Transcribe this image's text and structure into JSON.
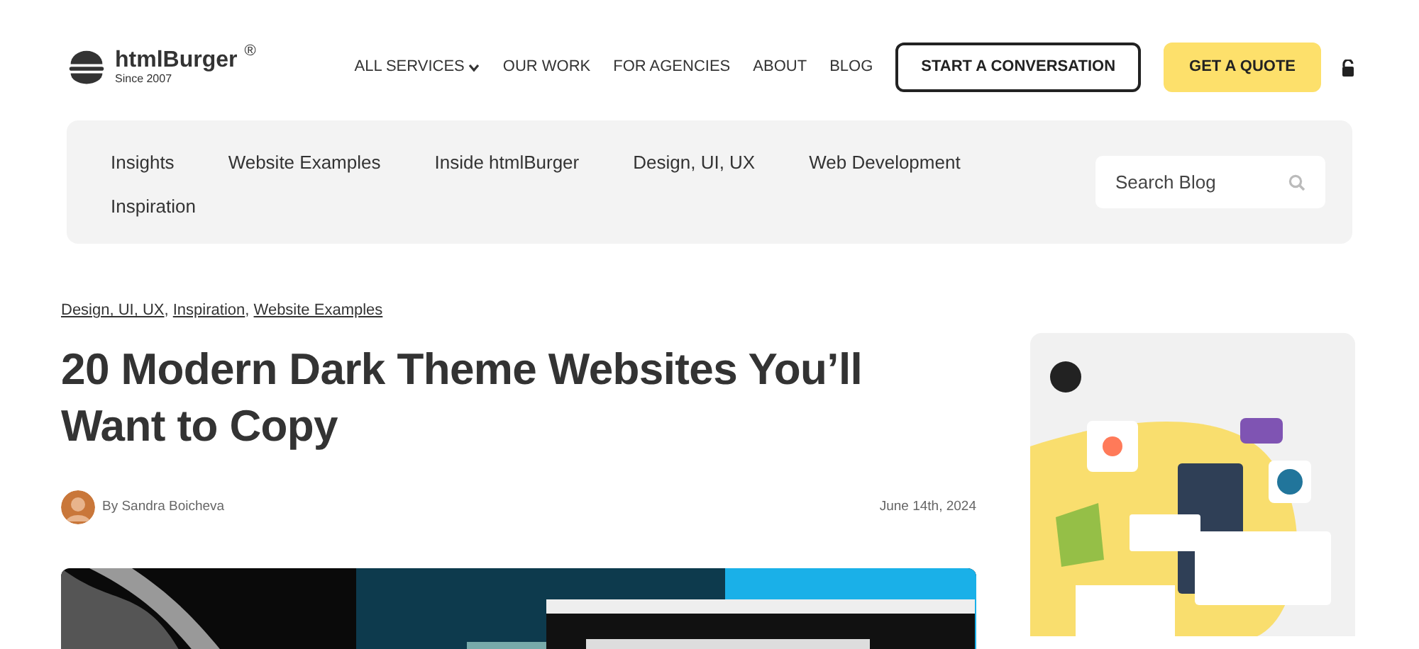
{
  "header": {
    "logo": {
      "name": "htmlBurger",
      "mark": "®",
      "since": "Since 2007"
    },
    "nav": [
      {
        "label": "ALL SERVICES",
        "kind": "dropdown"
      },
      {
        "label": "OUR WORK",
        "kind": "link"
      },
      {
        "label": "FOR AGENCIES",
        "kind": "link"
      },
      {
        "label": "ABOUT",
        "kind": "link"
      },
      {
        "label": "BLOG",
        "kind": "link"
      }
    ],
    "buttons": [
      {
        "label": "START A CONVERSATION",
        "kind": "outline"
      },
      {
        "label": "GET A QUOTE",
        "kind": "primary"
      }
    ]
  },
  "blog_categories": {
    "items": [
      "Insights",
      "Website Examples",
      "Inside htmlBurger",
      "Design, UI, UX",
      "Web Development",
      "Inspiration"
    ],
    "search": {
      "placeholder": "Search Blog"
    }
  },
  "article": {
    "categories": [
      "Design, UI, UX",
      "Inspiration",
      "Website Examples"
    ],
    "category_separator": ",",
    "title": "20 Modern Dark Theme Websites You’ll Want to Copy",
    "author": "By Sandra Boicheva",
    "date": "June 14th, 2024"
  }
}
